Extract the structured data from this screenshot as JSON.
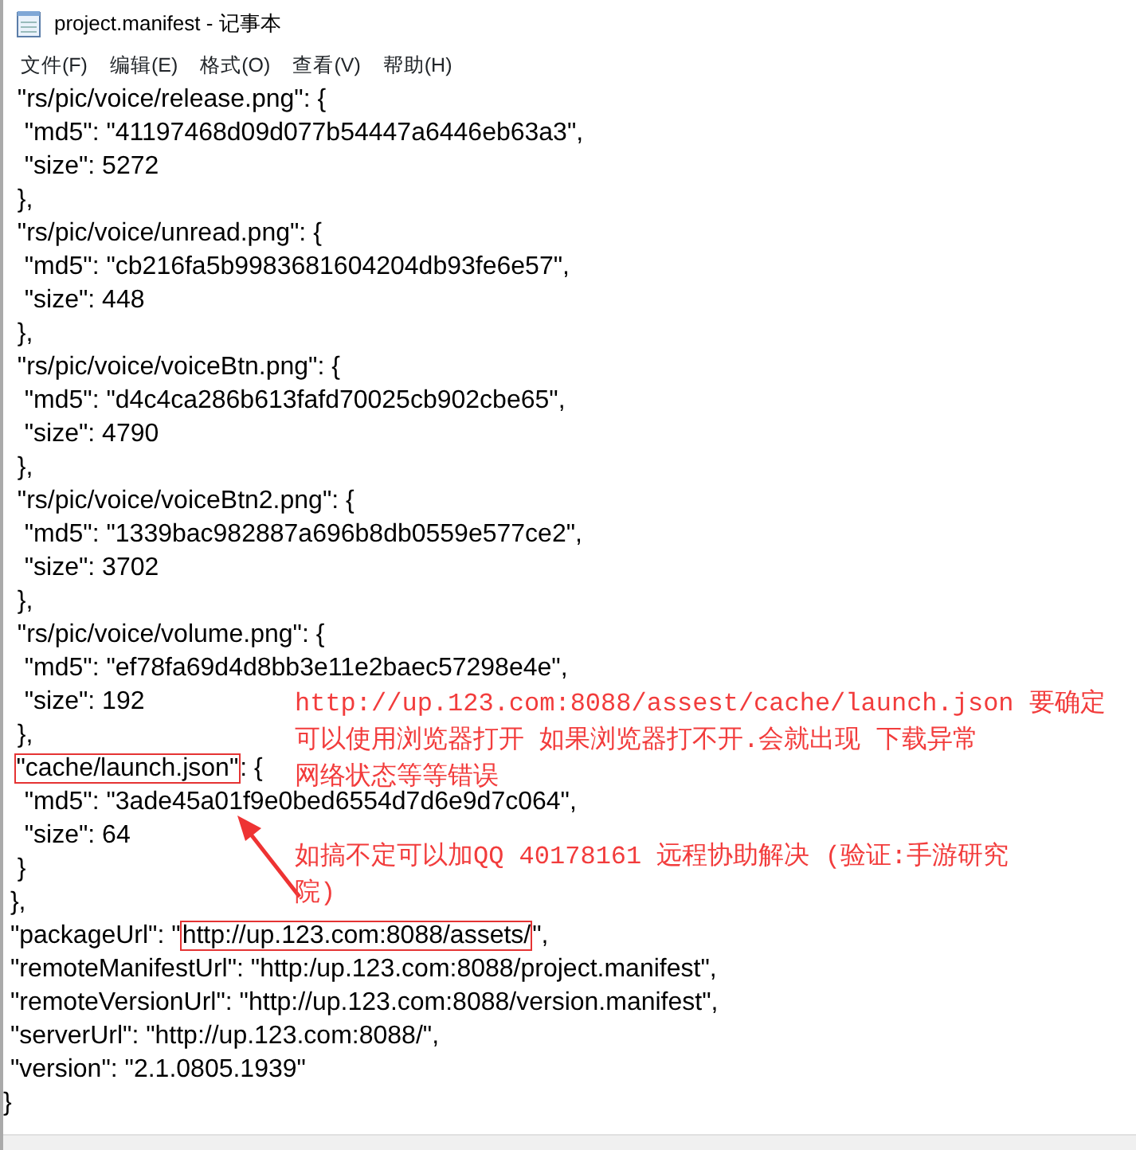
{
  "window": {
    "title": "project.manifest - 记事本"
  },
  "menu": [
    "文件(F)",
    "编辑(E)",
    "格式(O)",
    "查看(V)",
    "帮助(H)"
  ],
  "lines": [
    {
      "kind": "plain",
      "text": "  \"rs/pic/voice/release.png\": {"
    },
    {
      "kind": "plain",
      "text": "   \"md5\": \"41197468d09d077b54447a6446eb63a3\","
    },
    {
      "kind": "plain",
      "text": "   \"size\": 5272"
    },
    {
      "kind": "plain",
      "text": "  },"
    },
    {
      "kind": "plain",
      "text": "  \"rs/pic/voice/unread.png\": {"
    },
    {
      "kind": "plain",
      "text": "   \"md5\": \"cb216fa5b9983681604204db93fe6e57\","
    },
    {
      "kind": "plain",
      "text": "   \"size\": 448"
    },
    {
      "kind": "plain",
      "text": "  },"
    },
    {
      "kind": "plain",
      "text": "  \"rs/pic/voice/voiceBtn.png\": {"
    },
    {
      "kind": "plain",
      "text": "   \"md5\": \"d4c4ca286b613fafd70025cb902cbe65\","
    },
    {
      "kind": "plain",
      "text": "   \"size\": 4790"
    },
    {
      "kind": "plain",
      "text": "  },"
    },
    {
      "kind": "plain",
      "text": "  \"rs/pic/voice/voiceBtn2.png\": {"
    },
    {
      "kind": "plain",
      "text": "   \"md5\": \"1339bac982887a696b8db0559e577ce2\","
    },
    {
      "kind": "plain",
      "text": "   \"size\": 3702"
    },
    {
      "kind": "plain",
      "text": "  },"
    },
    {
      "kind": "plain",
      "text": "  \"rs/pic/voice/volume.png\": {"
    },
    {
      "kind": "plain",
      "text": "   \"md5\": \"ef78fa69d4d8bb3e11e2baec57298e4e\","
    },
    {
      "kind": "plain",
      "text": "   \"size\": 192"
    },
    {
      "kind": "plain",
      "text": "  },"
    },
    {
      "kind": "boxed",
      "boxed": "\"cache/launch.json\"",
      "after": ": {"
    },
    {
      "kind": "plain",
      "text": "   \"md5\": \"3ade45a01f9e0bed6554d7d6e9d7c064\","
    },
    {
      "kind": "plain",
      "text": "   \"size\": 64"
    },
    {
      "kind": "plain",
      "text": "  }"
    },
    {
      "kind": "plain",
      "text": " },"
    },
    {
      "kind": "boxed",
      "before": " \"packageUrl\": \"",
      "boxed": "http://up.123.com:8088/assets/",
      "after": "\","
    },
    {
      "kind": "plain",
      "text": " \"remoteManifestUrl\": \"http:/up.123.com:8088/project.manifest\","
    },
    {
      "kind": "plain",
      "text": " \"remoteVersionUrl\": \"http://up.123.com:8088/version.manifest\","
    },
    {
      "kind": "plain",
      "text": " \"serverUrl\": \"http://up.123.com:8088/\","
    },
    {
      "kind": "plain",
      "text": " \"version\": \"2.1.0805.1939\""
    },
    {
      "kind": "plain",
      "text": "}"
    }
  ],
  "annotations": [
    {
      "lines": [
        "http://up.123.com:8088/assest/cache/launch.json 要确定",
        "可以使用浏览器打开 如果浏览器打不开.会就出现 下载异常",
        "网络状态等等错误"
      ]
    },
    {
      "lines": [
        "如搞不定可以加QQ 40178161 远程协助解决 (验证:手游研究",
        "院)"
      ]
    }
  ]
}
